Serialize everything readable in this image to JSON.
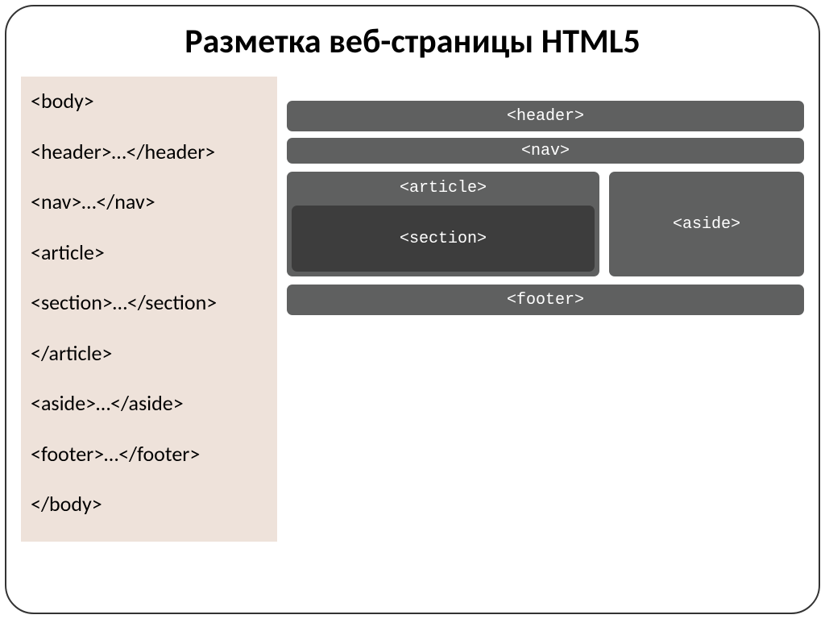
{
  "title": "Разметка веб-страницы HTML5",
  "code": {
    "l0": "<body>",
    "l1": "<header>…</header>",
    "l2": "<nav>…</nav>",
    "l3": "<article>",
    "l4": "<section>…</section>",
    "l5": "</article>",
    "l6": "<aside>…</aside>",
    "l7": "<footer>…</footer>",
    "l8": "</body>"
  },
  "diagram": {
    "header": "<header>",
    "nav": "<nav>",
    "article": "<article>",
    "section": "<section>",
    "aside": "<aside>",
    "footer": "<footer>"
  }
}
